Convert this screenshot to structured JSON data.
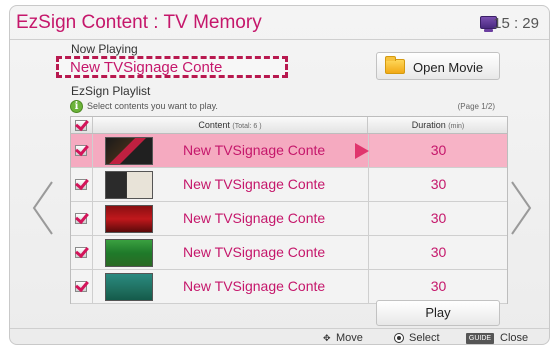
{
  "header": {
    "title": "EzSign Content : TV Memory",
    "time": "15 : 29",
    "tv_icon": "tv-icon"
  },
  "now_playing": {
    "label": "Now Playing",
    "value": "New TVSignage Conte"
  },
  "open_movie": {
    "label": "Open Movie",
    "icon": "folder-icon"
  },
  "playlist": {
    "label": "EzSign Playlist",
    "hint": "Select contents you want to play.",
    "page": "(Page 1/2)",
    "columns": {
      "content": "Content",
      "content_total": "(Total: 6 )",
      "duration": "Duration",
      "duration_unit": "(min)"
    },
    "rows": [
      {
        "name": "New TVSignage Conte",
        "duration": "30",
        "checked": true,
        "selected": true
      },
      {
        "name": "New TVSignage Conte",
        "duration": "30",
        "checked": true,
        "selected": false
      },
      {
        "name": "New TVSignage Conte",
        "duration": "30",
        "checked": true,
        "selected": false
      },
      {
        "name": "New TVSignage Conte",
        "duration": "30",
        "checked": true,
        "selected": false
      },
      {
        "name": "New TVSignage Conte",
        "duration": "30",
        "checked": true,
        "selected": false
      }
    ]
  },
  "play_button": "Play",
  "footer": {
    "move": "Move",
    "select": "Select",
    "guide_key": "GUIDE",
    "close": "Close"
  },
  "colors": {
    "accent": "#c5176b",
    "selected_row": "#f5aac0",
    "info": "#6cb43a"
  }
}
